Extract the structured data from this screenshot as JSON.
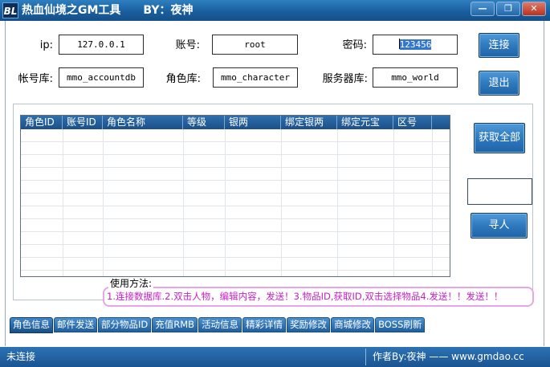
{
  "window": {
    "logo": "BL",
    "title": "热血仙境之GM工具　　BY：夜神",
    "minimize_glyph": "—",
    "restore_glyph": "❐",
    "close_glyph": "✕"
  },
  "connection": {
    "ip_label": "ip:",
    "ip_value": "127.0.0.1",
    "account_label": "账号:",
    "account_value": "root",
    "password_label": "密码:",
    "password_selected": "123456",
    "account_db_label": "帐号库:",
    "account_db_value": "mmo_accountdb",
    "character_db_label": "角色库:",
    "character_db_value": "mmo_character",
    "server_db_label": "服务器库:",
    "server_db_value": "mmo_world",
    "connect_button": "连接",
    "exit_button": "退出"
  },
  "grid": {
    "columns": [
      "角色ID",
      "账号ID",
      "角色名称",
      "等级",
      "银两",
      "绑定银两",
      "绑定元宝",
      "区号"
    ],
    "rows": []
  },
  "side": {
    "get_all_button": "获取全部",
    "find_button": "寻人",
    "find_input_value": ""
  },
  "usage": {
    "title": "使用方法:",
    "text": "1.连接数据库.2.双击人物，编辑内容，发送！3.物品ID,获取ID,双击选择物品4.发送！！发送！！"
  },
  "tabs": [
    "角色信息",
    "邮件发送",
    "部分物品ID",
    "充值RMB",
    "活动信息",
    "精彩详情",
    "奖励修改",
    "商城修改",
    "BOSS刷新"
  ],
  "active_tab": "角色信息",
  "status": {
    "connection": "未连接",
    "author": "作者By:夜神 —— www.gmdao.cc"
  },
  "colors": {
    "titlebar": "#1a5f9f",
    "button": "#2f79bd",
    "usage_text": "#c81ec8",
    "usage_border": "#e6a6e6"
  }
}
